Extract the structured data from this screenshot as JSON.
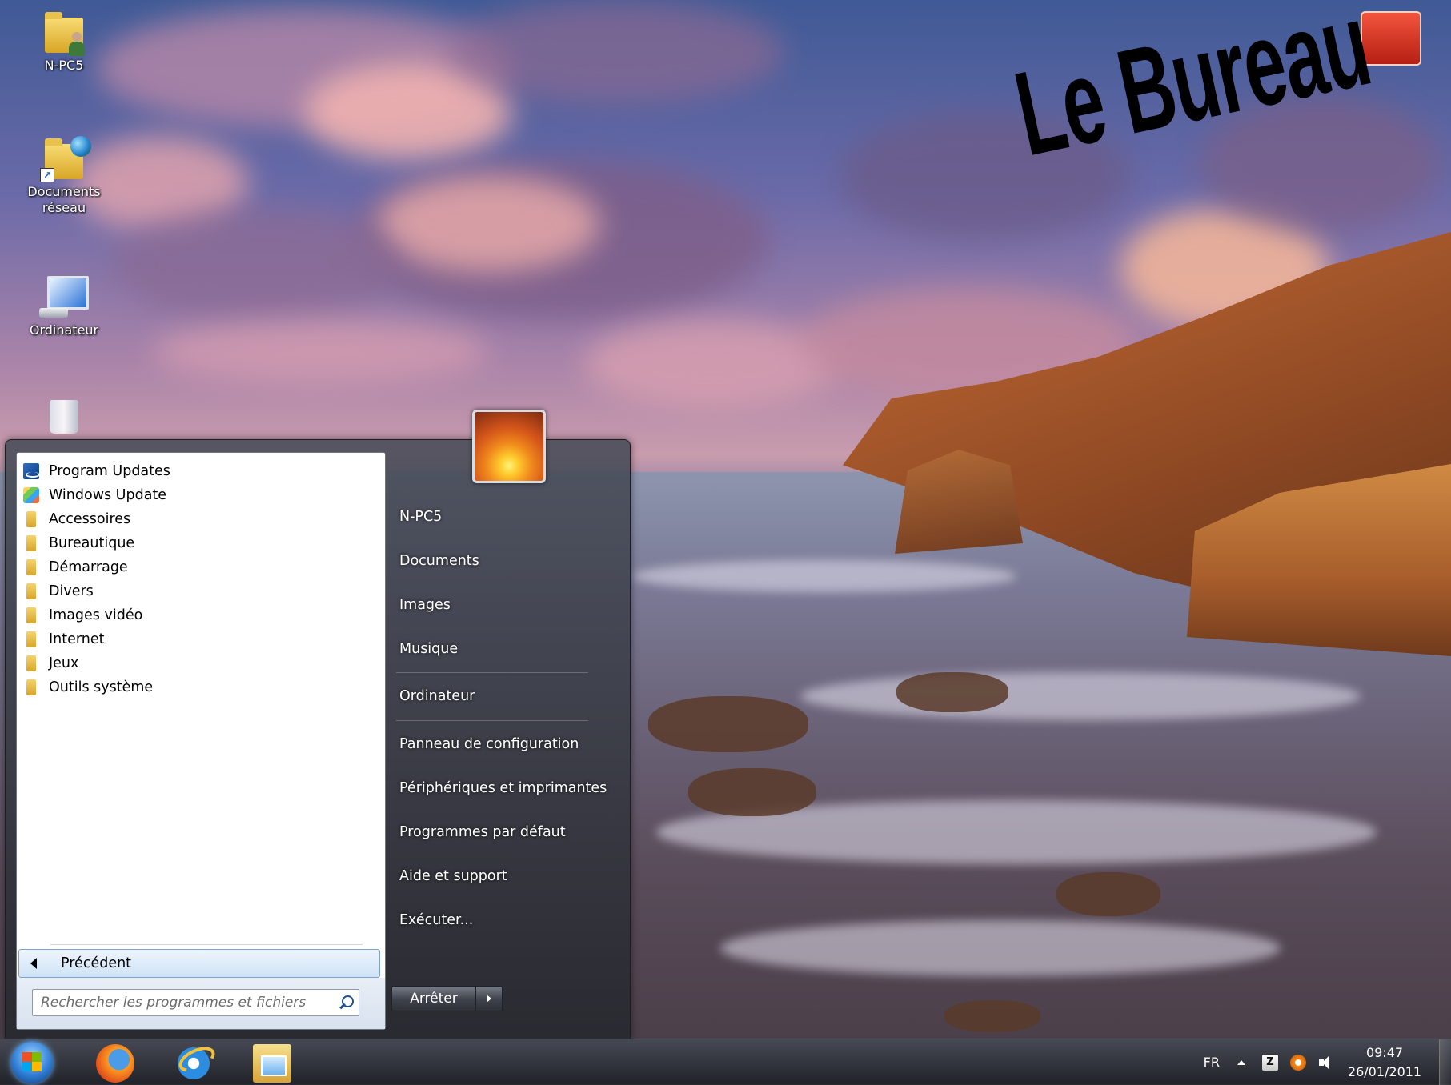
{
  "desktop": {
    "icons": [
      {
        "label": "N-PC5"
      },
      {
        "label": "Documents\nréseau"
      },
      {
        "label": "Ordinateur"
      },
      {
        "label": ""
      }
    ],
    "overlay_title": "Le Bureau"
  },
  "start_menu": {
    "programs": [
      {
        "label": "Program Updates",
        "icon": "program-updates-icon"
      },
      {
        "label": "Windows Update",
        "icon": "windows-update-icon"
      },
      {
        "label": "Accessoires",
        "icon": "folder-icon"
      },
      {
        "label": "Bureautique",
        "icon": "folder-icon"
      },
      {
        "label": "Démarrage",
        "icon": "folder-icon"
      },
      {
        "label": "Divers",
        "icon": "folder-icon"
      },
      {
        "label": "Images vidéo",
        "icon": "folder-icon"
      },
      {
        "label": "Internet",
        "icon": "folder-icon"
      },
      {
        "label": "Jeux",
        "icon": "folder-icon"
      },
      {
        "label": "Outils système",
        "icon": "folder-icon"
      }
    ],
    "back_label": "Précédent",
    "search_placeholder": "Rechercher les programmes et fichiers",
    "right_items": [
      {
        "label": "N-PC5"
      },
      {
        "label": "Documents"
      },
      {
        "label": "Images"
      },
      {
        "label": "Musique"
      },
      {
        "label": "Ordinateur"
      },
      {
        "label": "Panneau de configuration"
      },
      {
        "label": "Périphériques et imprimantes"
      },
      {
        "label": "Programmes par défaut"
      },
      {
        "label": "Aide et support"
      },
      {
        "label": "Exécuter..."
      }
    ],
    "shutdown_label": "Arrêter"
  },
  "taskbar": {
    "pinned": [
      {
        "name": "firefox-icon"
      },
      {
        "name": "internet-explorer-icon"
      },
      {
        "name": "windows-explorer-icon"
      }
    ],
    "tray": {
      "language": "FR",
      "zone_alarm_glyph": "Z",
      "time": "09:47",
      "date": "26/01/2011"
    }
  },
  "colors": {
    "start_menu_glass": "#3e4250",
    "back_item_highlight": "#cfe3f7",
    "taskbar": "#2a2d35"
  }
}
